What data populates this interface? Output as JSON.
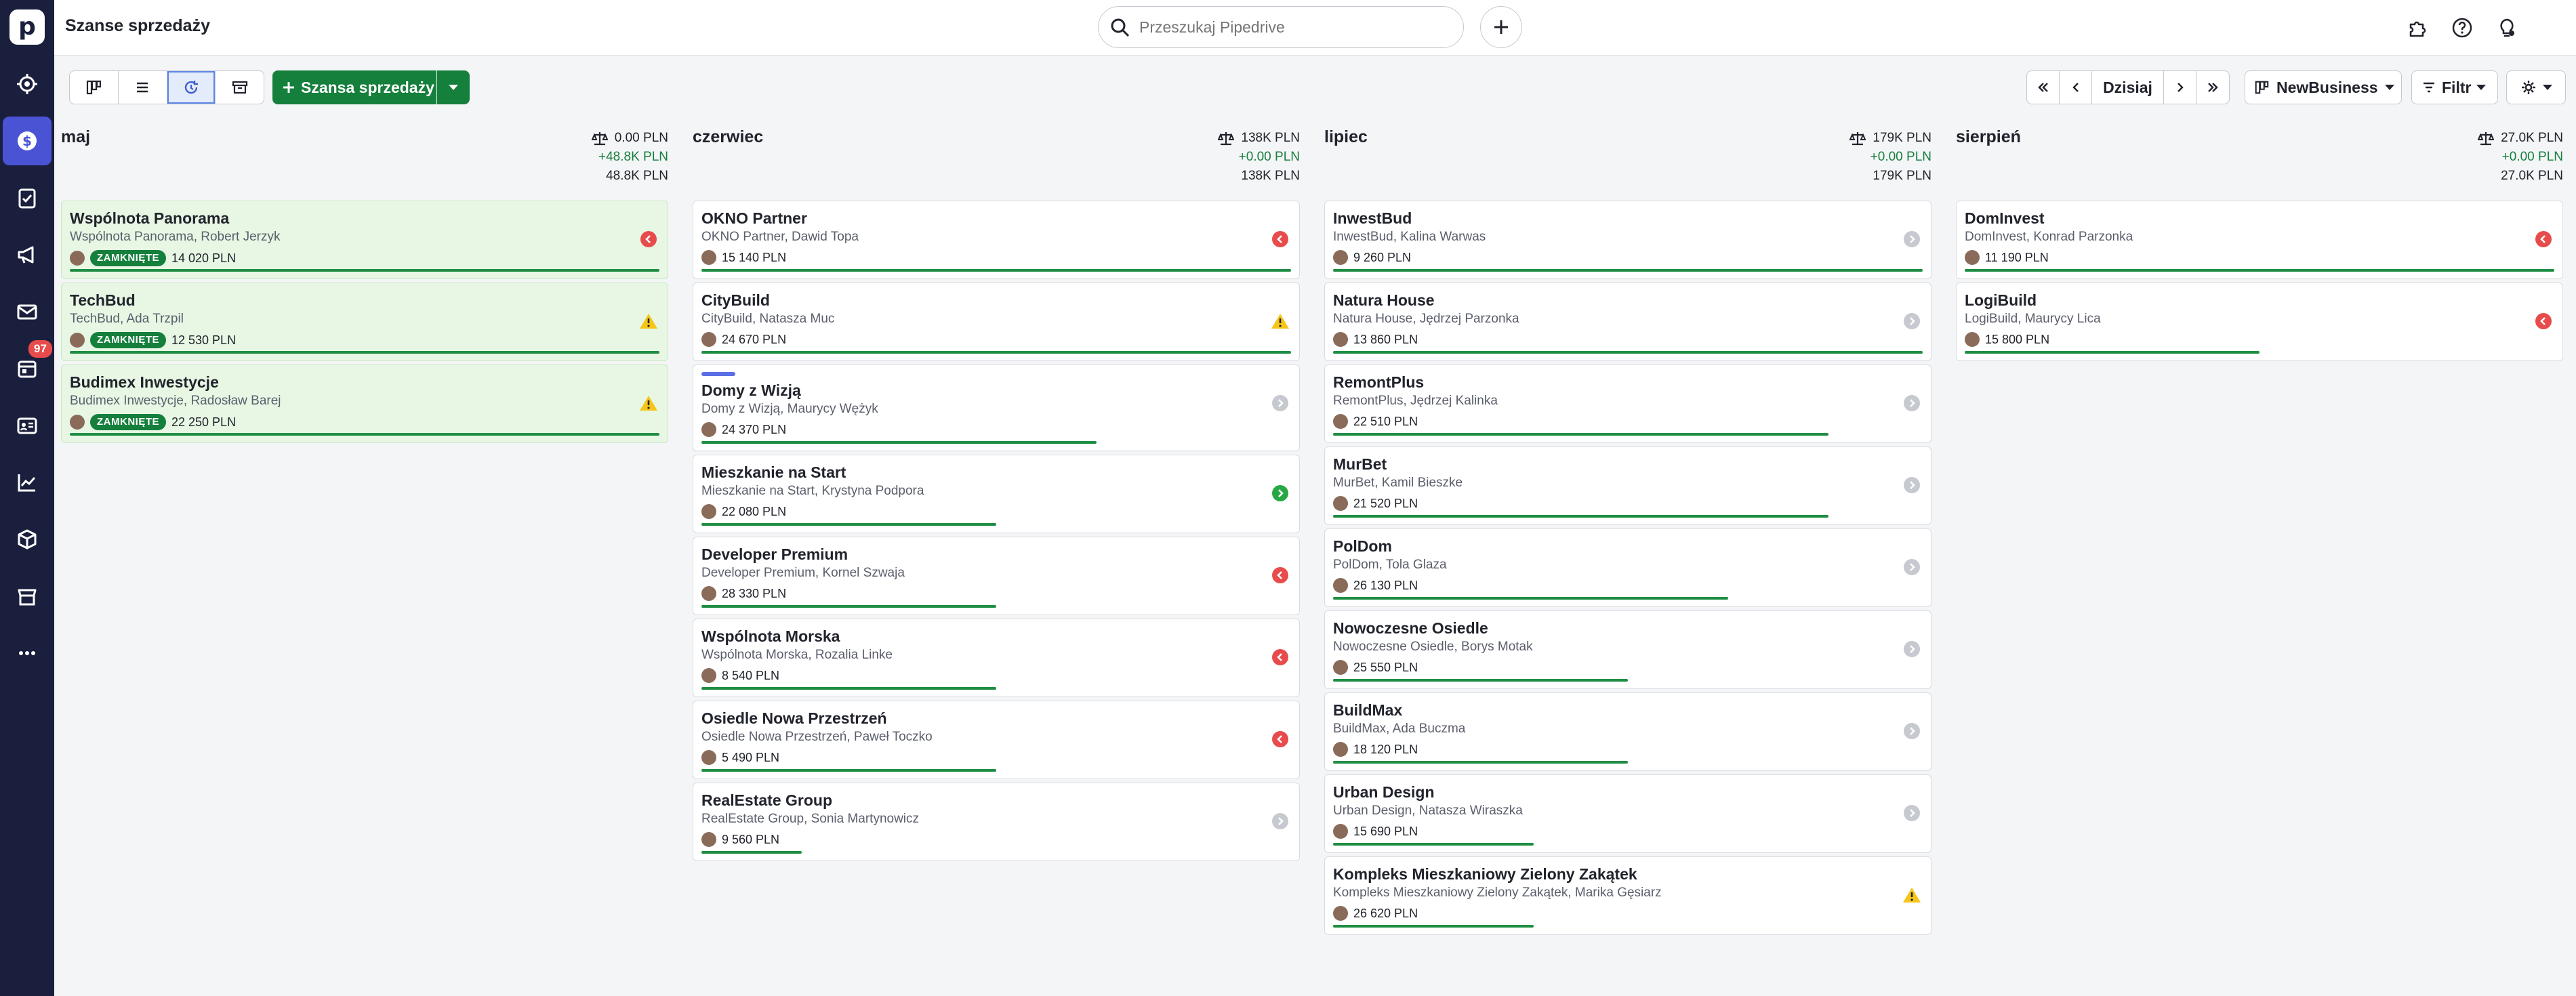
{
  "app": {
    "title": "Szanse sprzedaży",
    "logo": "p"
  },
  "search": {
    "placeholder": "Przeszukaj Pipedrive"
  },
  "sidebar": {
    "items": [
      {
        "icon": "target-icon",
        "name": "sidebar-item-leads"
      },
      {
        "icon": "dollar-icon",
        "name": "sidebar-item-deals",
        "active": true
      },
      {
        "icon": "checklist-icon",
        "name": "sidebar-item-activities"
      },
      {
        "icon": "megaphone-icon",
        "name": "sidebar-item-campaigns"
      },
      {
        "icon": "mail-icon",
        "name": "sidebar-item-mail"
      },
      {
        "icon": "calendar-icon",
        "name": "sidebar-item-calendar",
        "badge": "97"
      },
      {
        "icon": "contacts-icon",
        "name": "sidebar-item-contacts"
      },
      {
        "icon": "chart-icon",
        "name": "sidebar-item-insights"
      },
      {
        "icon": "box-icon",
        "name": "sidebar-item-products"
      },
      {
        "icon": "store-icon",
        "name": "sidebar-item-marketplace"
      },
      {
        "icon": "more-icon",
        "name": "sidebar-item-more"
      }
    ]
  },
  "toolbar": {
    "add_label": "Szansa sprzedaży",
    "today_label": "Dzisiaj",
    "pipeline_label": "NewBusiness",
    "filter_label": "Filtr"
  },
  "columns": [
    {
      "name": "maj",
      "sum_total": "0.00 PLN",
      "sum_weighted": "+48.8K PLN",
      "sum_all": "48.8K PLN",
      "cards": [
        {
          "title": "Wspólnota Panorama",
          "subtitle": "Wspólnota Panorama, Robert Jerzyk",
          "value": "14 020 PLN",
          "badge": "ZAMKNIĘTE",
          "status": "red",
          "won": true,
          "progress": 1.0
        },
        {
          "title": "TechBud",
          "subtitle": "TechBud, Ada Trzpil",
          "value": "12 530 PLN",
          "badge": "ZAMKNIĘTE",
          "status": "warn",
          "won": true,
          "progress": 1.0
        },
        {
          "title": "Budimex Inwestycje",
          "subtitle": "Budimex Inwestycje, Radosław Barej",
          "value": "22 250 PLN",
          "badge": "ZAMKNIĘTE",
          "status": "warn",
          "won": true,
          "progress": 1.0
        }
      ]
    },
    {
      "name": "czerwiec",
      "sum_total": "138K PLN",
      "sum_weighted": "+0.00 PLN",
      "sum_all": "138K PLN",
      "cards": [
        {
          "title": "OKNO Partner",
          "subtitle": "OKNO Partner, Dawid Topa",
          "value": "15 140 PLN",
          "status": "red",
          "progress": 1.0
        },
        {
          "title": "CityBuild",
          "subtitle": "CityBuild, Natasza Muc",
          "value": "24 670 PLN",
          "status": "warn",
          "progress": 1.0
        },
        {
          "title": "Domy z Wizją",
          "subtitle": "Domy z Wizją, Maurycy Wężyk",
          "value": "24 370 PLN",
          "status": "grey",
          "progress": 0.67,
          "tag": true
        },
        {
          "title": "Mieszkanie na Start",
          "subtitle": "Mieszkanie na Start, Krystyna Podpora",
          "value": "22 080 PLN",
          "status": "green",
          "progress": 0.5
        },
        {
          "title": "Developer Premium",
          "subtitle": "Developer Premium, Kornel Szwaja",
          "value": "28 330 PLN",
          "status": "red",
          "progress": 0.5
        },
        {
          "title": "Wspólnota Morska",
          "subtitle": "Wspólnota Morska, Rozalia Linke",
          "value": "8 540 PLN",
          "status": "red",
          "progress": 0.5
        },
        {
          "title": "Osiedle Nowa Przestrzeń",
          "subtitle": "Osiedle Nowa Przestrzeń, Paweł Toczko",
          "value": "5 490 PLN",
          "status": "red",
          "progress": 0.5
        },
        {
          "title": "RealEstate Group",
          "subtitle": "RealEstate Group, Sonia Martynowicz",
          "value": "9 560 PLN",
          "status": "grey",
          "progress": 0.17
        }
      ]
    },
    {
      "name": "lipiec",
      "sum_total": "179K PLN",
      "sum_weighted": "+0.00 PLN",
      "sum_all": "179K PLN",
      "cards": [
        {
          "title": "InwestBud",
          "subtitle": "InwestBud, Kalina Warwas",
          "value": "9 260 PLN",
          "status": "grey",
          "progress": 1.0
        },
        {
          "title": "Natura House",
          "subtitle": "Natura House, Jędrzej Parzonka",
          "value": "13 860 PLN",
          "status": "grey",
          "progress": 1.0
        },
        {
          "title": "RemontPlus",
          "subtitle": "RemontPlus, Jędrzej Kalinka",
          "value": "22 510 PLN",
          "status": "grey",
          "progress": 0.84
        },
        {
          "title": "MurBet",
          "subtitle": "MurBet, Kamil Bieszke",
          "value": "21 520 PLN",
          "status": "grey",
          "progress": 0.84
        },
        {
          "title": "PolDom",
          "subtitle": "PolDom, Tola Glaza",
          "value": "26 130 PLN",
          "status": "grey",
          "progress": 0.67
        },
        {
          "title": "Nowoczesne Osiedle",
          "subtitle": "Nowoczesne Osiedle, Borys Motak",
          "value": "25 550 PLN",
          "status": "grey",
          "progress": 0.5
        },
        {
          "title": "BuildMax",
          "subtitle": "BuildMax, Ada Buczma",
          "value": "18 120 PLN",
          "status": "grey",
          "progress": 0.5
        },
        {
          "title": "Urban Design",
          "subtitle": "Urban Design, Natasza Wiraszka",
          "value": "15 690 PLN",
          "status": "grey",
          "progress": 0.34
        },
        {
          "title": "Kompleks Mieszkaniowy Zielony Zakątek",
          "subtitle": "Kompleks Mieszkaniowy Zielony Zakątek, Marika Gęsiarz",
          "value": "26 620 PLN",
          "status": "warn",
          "progress": 0.34
        }
      ]
    },
    {
      "name": "sierpień",
      "sum_total": "27.0K PLN",
      "sum_weighted": "+0.00 PLN",
      "sum_all": "27.0K PLN",
      "cards": [
        {
          "title": "DomInvest",
          "subtitle": "DomInvest, Konrad Parzonka",
          "value": "11 190 PLN",
          "status": "red",
          "progress": 1.0
        },
        {
          "title": "LogiBuild",
          "subtitle": "LogiBuild, Maurycy Lica",
          "value": "15 800 PLN",
          "status": "red",
          "progress": 0.5
        }
      ]
    }
  ]
}
